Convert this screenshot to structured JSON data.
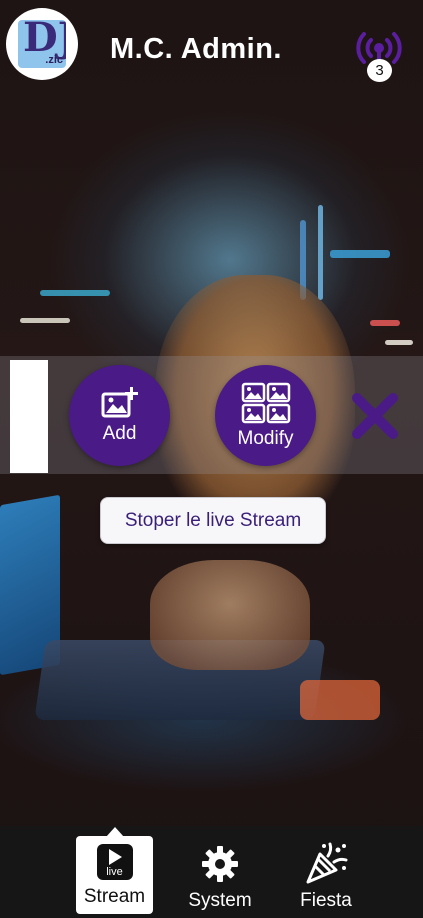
{
  "header": {
    "logo_main": "DJ",
    "logo_sub": ".zic",
    "title": "M.C. Admin.",
    "live_count": "3"
  },
  "overlay": {
    "add_label": "Add",
    "modify_label": "Modify",
    "stop_stream_label": "Stoper le live Stream"
  },
  "bottom_nav": {
    "items": [
      {
        "label": "Stream",
        "icon": "live-stream-icon",
        "active": true
      },
      {
        "label": "System",
        "icon": "gear-icon",
        "active": false
      },
      {
        "label": "Fiesta",
        "icon": "party-popper-icon",
        "active": false
      }
    ],
    "live_icon_text": "live"
  },
  "colors": {
    "accent": "#4a1a86",
    "nav_bg": "#161616",
    "broadcast_icon": "#5b1e9e"
  }
}
